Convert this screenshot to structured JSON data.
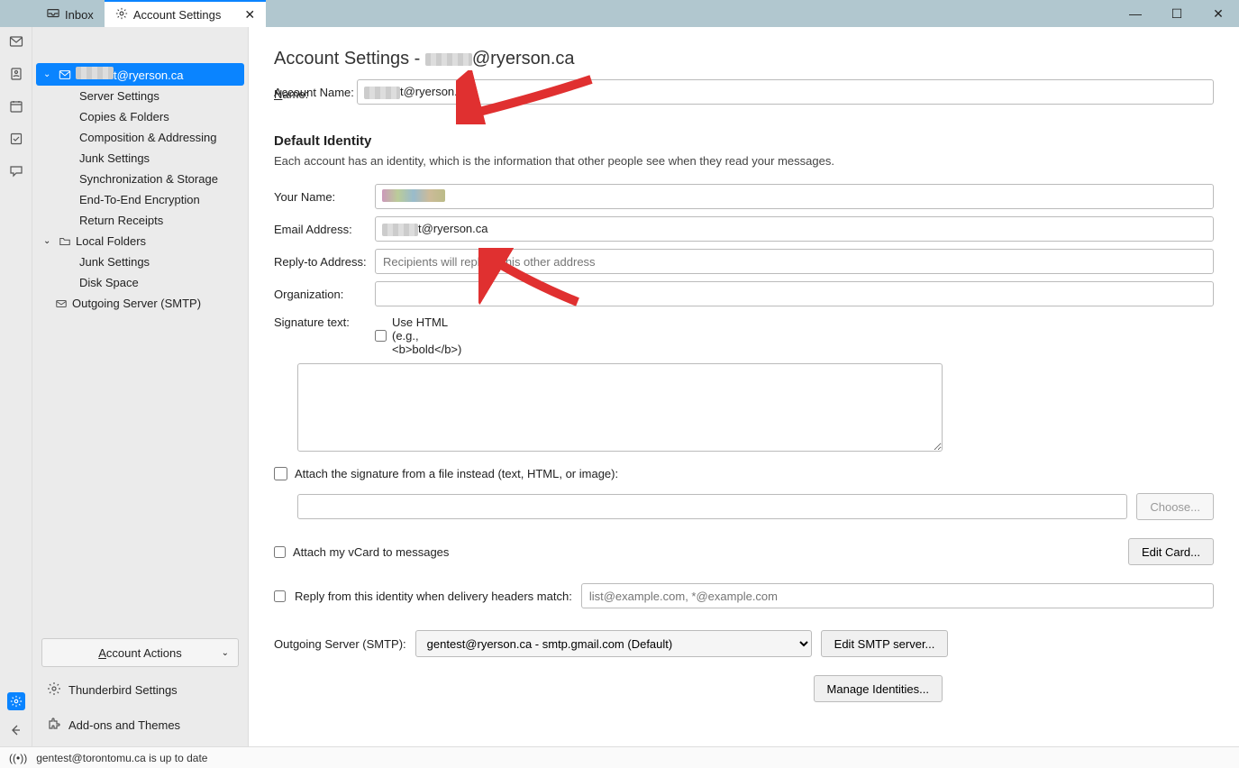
{
  "tabs": {
    "inbox": "Inbox",
    "settings": "Account Settings"
  },
  "sidebar": {
    "account_email_suffix": "t@ryerson.ca",
    "items": [
      "Server Settings",
      "Copies & Folders",
      "Composition & Addressing",
      "Junk Settings",
      "Synchronization & Storage",
      "End-To-End Encryption",
      "Return Receipts"
    ],
    "local_folders": "Local Folders",
    "local_items": [
      "Junk Settings",
      "Disk Space"
    ],
    "outgoing": "Outgoing Server (SMTP)",
    "account_actions": "Account Actions",
    "thunderbird_settings": "Thunderbird Settings",
    "addons": "Add-ons and Themes"
  },
  "page": {
    "title_prefix": "Account Settings - ",
    "title_suffix": "@ryerson.ca",
    "account_name_label": "Account Name:",
    "account_name_value_suffix": "t@ryerson.ca",
    "default_identity": "Default Identity",
    "identity_desc": "Each account has an identity, which is the information that other people see when they read your messages.",
    "your_name_label": "Your Name:",
    "email_label": "Email Address:",
    "email_value_suffix": "t@ryerson.ca",
    "replyto_label": "Reply-to Address:",
    "replyto_placeholder": "Recipients will reply to this other address",
    "org_label": "Organization:",
    "sig_label": "Signature text:",
    "use_html": "Use HTML (e.g., <b>bold</b>)",
    "attach_sig": "Attach the signature from a file instead (text, HTML, or image):",
    "choose": "Choose...",
    "attach_vcard": "Attach my vCard to messages",
    "edit_card": "Edit Card...",
    "reply_identity": "Reply from this identity when delivery headers match:",
    "reply_placeholder": "list@example.com, *@example.com",
    "outgoing_label": "Outgoing Server (SMTP):",
    "outgoing_value": "gentest@ryerson.ca - smtp.gmail.com (Default)",
    "edit_smtp": "Edit SMTP server...",
    "manage_id": "Manage Identities..."
  },
  "status": "gentest@torontomu.ca is up to date"
}
